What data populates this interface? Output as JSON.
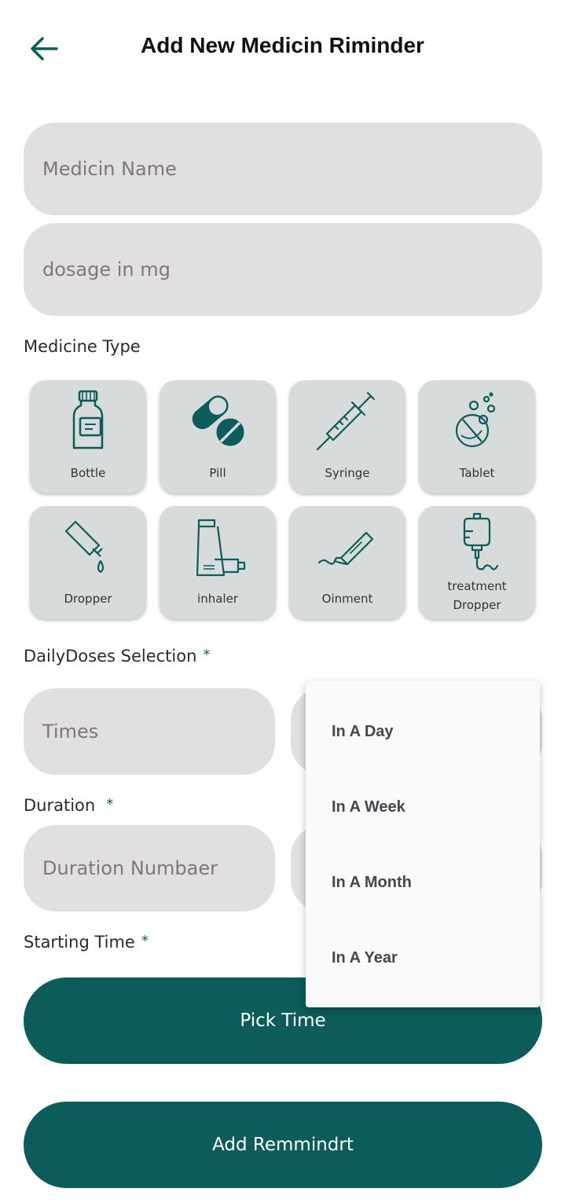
{
  "header": {
    "title": "Add New Medicin Riminder",
    "back_icon": "arrow-left-icon"
  },
  "form": {
    "medicine_name_placeholder": "Medicin Name",
    "dosage_placeholder": "dosage in mg",
    "medicine_type_label": "Medicine Type",
    "medicine_types": [
      {
        "label": "Bottle",
        "icon": "bottle-icon"
      },
      {
        "label": "Pill",
        "icon": "pill-icon"
      },
      {
        "label": "Syringe",
        "icon": "syringe-icon"
      },
      {
        "label": "Tablet",
        "icon": "tablet-icon"
      },
      {
        "label": "Dropper",
        "icon": "dropper-icon"
      },
      {
        "label": "inhaler",
        "icon": "inhaler-icon"
      },
      {
        "label": "Oinment",
        "icon": "ointment-icon"
      },
      {
        "label": "treatment Dropper",
        "icon": "iv-drip-icon"
      }
    ],
    "daily_doses_label": "DailyDoses Selection",
    "required_mark": "*",
    "times_placeholder": "Times",
    "duration_label": "Duration",
    "duration_placeholder": "Duration Numbaer",
    "starting_time_label": "Starting Time",
    "pick_time_label": "Pick Time",
    "add_reminder_label": "Add Remmindrt"
  },
  "frequency_menu": {
    "options": [
      "In A Day",
      "In A Week",
      "In A Month",
      "In A Year"
    ]
  },
  "colors": {
    "primary": "#0b5c5a",
    "field_bg": "#e1e0df",
    "card_bg": "#d8dbdb",
    "placeholder": "#7f7680"
  }
}
